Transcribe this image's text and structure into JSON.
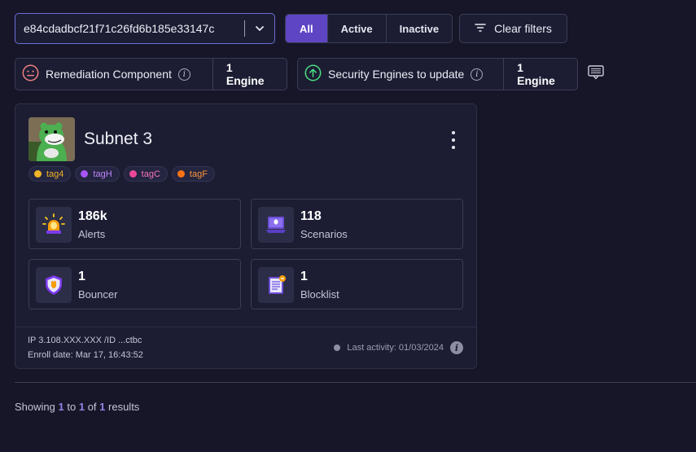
{
  "filters": {
    "search_value": "e84cdadbcf21f71c26fd6b185e33147c",
    "status_options": [
      "All",
      "Active",
      "Inactive"
    ],
    "selected_status": "All",
    "clear_label": "Clear filters"
  },
  "summary": {
    "remediation": {
      "label": "Remediation Component",
      "count": "1 Engine"
    },
    "updates": {
      "label": "Security Engines to update",
      "count": "1 Engine"
    }
  },
  "card": {
    "title": "Subnet 3",
    "tags": [
      {
        "label": "tag4",
        "color": "#f0b429"
      },
      {
        "label": "tagH",
        "color": "#a855f7"
      },
      {
        "label": "tagC",
        "color": "#ec4899"
      },
      {
        "label": "tagF",
        "color": "#f97316"
      }
    ],
    "metrics": [
      {
        "value": "186k",
        "label": "Alerts",
        "icon": "siren-icon"
      },
      {
        "value": "118",
        "label": "Scenarios",
        "icon": "laptop-icon"
      },
      {
        "value": "1",
        "label": "Bouncer",
        "icon": "shield-icon"
      },
      {
        "value": "1",
        "label": "Blocklist",
        "icon": "book-icon"
      }
    ],
    "ip": "IP 3.108.XXX.XXX /ID ...ctbc",
    "enroll": "Enroll date: Mar 17, 16:43:52",
    "last_activity": "Last activity: 01/03/2024"
  },
  "pagination": {
    "prefix": "Showing",
    "from": "1",
    "to_word": "to",
    "to": "1",
    "of_word": "of",
    "total": "1",
    "suffix": "results"
  },
  "colors": {
    "accent": "#5d45c4",
    "background": "#161628",
    "panel": "#1c1d33"
  }
}
